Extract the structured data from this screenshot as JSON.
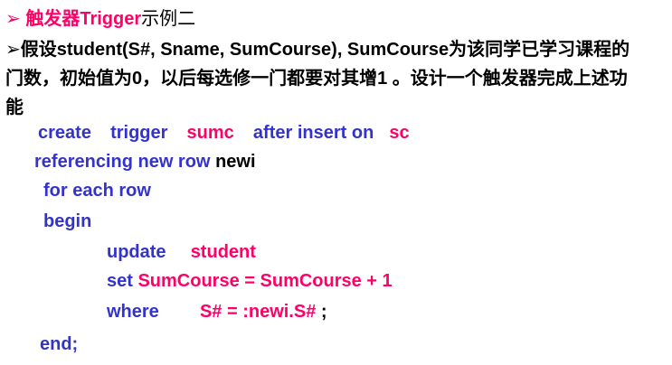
{
  "heading": {
    "bullet": "➢",
    "prefix": "触发器",
    "keyword": "Trigger",
    "suffix": "示例二"
  },
  "desc": {
    "bullet": "➢",
    "line1": "假设student(S#, Sname, SumCourse), SumCourse为该同学已学习课程的",
    "line2": "门数，初始值为0，以后每选修一门都要对其增1 。设计一个触发器完成上述功",
    "line3": "能"
  },
  "code": {
    "l1": {
      "create": "create",
      "trigger": "trigger",
      "name": "sumc",
      "after": "after",
      "insert": "insert",
      "on": "on",
      "table": "sc"
    },
    "l2": {
      "referencing": "referencing new row",
      "alias": "newi"
    },
    "l3": {
      "foreach": "for each row"
    },
    "l4": {
      "begin": "begin"
    },
    "l5": {
      "update": "update",
      "table": "student"
    },
    "l6": {
      "set": "set",
      "expr": "SumCourse = SumCourse + 1"
    },
    "l7": {
      "where": "where",
      "cond": "S# = :newi.S#",
      "semi": ";"
    },
    "l8": {
      "end": "end;"
    }
  },
  "colors": {
    "keyword": "#3333cc",
    "name": "#ff0066",
    "text": "#000000"
  }
}
